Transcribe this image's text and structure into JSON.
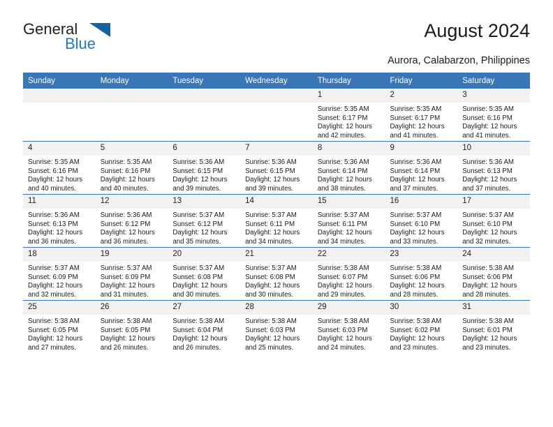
{
  "brand": {
    "line1": "General",
    "line2": "Blue",
    "triangle_icon": "blue-triangle-logo-mark",
    "color_dark": "#231f20",
    "color_blue": "#1f7ac4"
  },
  "header": {
    "title": "August 2024",
    "subtitle": "Aurora, Calabarzon, Philippines"
  },
  "theme": {
    "header_bg": "#3876b8",
    "header_text": "#ffffff",
    "daynum_bg": "#f1f1f1",
    "cell_bg": "#ffffff",
    "divider": "#3876b8"
  },
  "calendar": {
    "weekday_headers": [
      "Sunday",
      "Monday",
      "Tuesday",
      "Wednesday",
      "Thursday",
      "Friday",
      "Saturday"
    ],
    "labels": {
      "sunrise": "Sunrise:",
      "sunset": "Sunset:",
      "daylight": "Daylight:"
    },
    "weeks": [
      [
        {
          "day": "",
          "empty": true
        },
        {
          "day": "",
          "empty": true
        },
        {
          "day": "",
          "empty": true
        },
        {
          "day": "",
          "empty": true
        },
        {
          "day": "1",
          "sunrise": "Sunrise: 5:35 AM",
          "sunset": "Sunset: 6:17 PM",
          "daylight": "Daylight: 12 hours and 42 minutes."
        },
        {
          "day": "2",
          "sunrise": "Sunrise: 5:35 AM",
          "sunset": "Sunset: 6:17 PM",
          "daylight": "Daylight: 12 hours and 41 minutes."
        },
        {
          "day": "3",
          "sunrise": "Sunrise: 5:35 AM",
          "sunset": "Sunset: 6:16 PM",
          "daylight": "Daylight: 12 hours and 41 minutes."
        }
      ],
      [
        {
          "day": "4",
          "sunrise": "Sunrise: 5:35 AM",
          "sunset": "Sunset: 6:16 PM",
          "daylight": "Daylight: 12 hours and 40 minutes."
        },
        {
          "day": "5",
          "sunrise": "Sunrise: 5:35 AM",
          "sunset": "Sunset: 6:16 PM",
          "daylight": "Daylight: 12 hours and 40 minutes."
        },
        {
          "day": "6",
          "sunrise": "Sunrise: 5:36 AM",
          "sunset": "Sunset: 6:15 PM",
          "daylight": "Daylight: 12 hours and 39 minutes."
        },
        {
          "day": "7",
          "sunrise": "Sunrise: 5:36 AM",
          "sunset": "Sunset: 6:15 PM",
          "daylight": "Daylight: 12 hours and 39 minutes."
        },
        {
          "day": "8",
          "sunrise": "Sunrise: 5:36 AM",
          "sunset": "Sunset: 6:14 PM",
          "daylight": "Daylight: 12 hours and 38 minutes."
        },
        {
          "day": "9",
          "sunrise": "Sunrise: 5:36 AM",
          "sunset": "Sunset: 6:14 PM",
          "daylight": "Daylight: 12 hours and 37 minutes."
        },
        {
          "day": "10",
          "sunrise": "Sunrise: 5:36 AM",
          "sunset": "Sunset: 6:13 PM",
          "daylight": "Daylight: 12 hours and 37 minutes."
        }
      ],
      [
        {
          "day": "11",
          "sunrise": "Sunrise: 5:36 AM",
          "sunset": "Sunset: 6:13 PM",
          "daylight": "Daylight: 12 hours and 36 minutes."
        },
        {
          "day": "12",
          "sunrise": "Sunrise: 5:36 AM",
          "sunset": "Sunset: 6:12 PM",
          "daylight": "Daylight: 12 hours and 36 minutes."
        },
        {
          "day": "13",
          "sunrise": "Sunrise: 5:37 AM",
          "sunset": "Sunset: 6:12 PM",
          "daylight": "Daylight: 12 hours and 35 minutes."
        },
        {
          "day": "14",
          "sunrise": "Sunrise: 5:37 AM",
          "sunset": "Sunset: 6:11 PM",
          "daylight": "Daylight: 12 hours and 34 minutes."
        },
        {
          "day": "15",
          "sunrise": "Sunrise: 5:37 AM",
          "sunset": "Sunset: 6:11 PM",
          "daylight": "Daylight: 12 hours and 34 minutes."
        },
        {
          "day": "16",
          "sunrise": "Sunrise: 5:37 AM",
          "sunset": "Sunset: 6:10 PM",
          "daylight": "Daylight: 12 hours and 33 minutes."
        },
        {
          "day": "17",
          "sunrise": "Sunrise: 5:37 AM",
          "sunset": "Sunset: 6:10 PM",
          "daylight": "Daylight: 12 hours and 32 minutes."
        }
      ],
      [
        {
          "day": "18",
          "sunrise": "Sunrise: 5:37 AM",
          "sunset": "Sunset: 6:09 PM",
          "daylight": "Daylight: 12 hours and 32 minutes."
        },
        {
          "day": "19",
          "sunrise": "Sunrise: 5:37 AM",
          "sunset": "Sunset: 6:09 PM",
          "daylight": "Daylight: 12 hours and 31 minutes."
        },
        {
          "day": "20",
          "sunrise": "Sunrise: 5:37 AM",
          "sunset": "Sunset: 6:08 PM",
          "daylight": "Daylight: 12 hours and 30 minutes."
        },
        {
          "day": "21",
          "sunrise": "Sunrise: 5:37 AM",
          "sunset": "Sunset: 6:08 PM",
          "daylight": "Daylight: 12 hours and 30 minutes."
        },
        {
          "day": "22",
          "sunrise": "Sunrise: 5:38 AM",
          "sunset": "Sunset: 6:07 PM",
          "daylight": "Daylight: 12 hours and 29 minutes."
        },
        {
          "day": "23",
          "sunrise": "Sunrise: 5:38 AM",
          "sunset": "Sunset: 6:06 PM",
          "daylight": "Daylight: 12 hours and 28 minutes."
        },
        {
          "day": "24",
          "sunrise": "Sunrise: 5:38 AM",
          "sunset": "Sunset: 6:06 PM",
          "daylight": "Daylight: 12 hours and 28 minutes."
        }
      ],
      [
        {
          "day": "25",
          "sunrise": "Sunrise: 5:38 AM",
          "sunset": "Sunset: 6:05 PM",
          "daylight": "Daylight: 12 hours and 27 minutes."
        },
        {
          "day": "26",
          "sunrise": "Sunrise: 5:38 AM",
          "sunset": "Sunset: 6:05 PM",
          "daylight": "Daylight: 12 hours and 26 minutes."
        },
        {
          "day": "27",
          "sunrise": "Sunrise: 5:38 AM",
          "sunset": "Sunset: 6:04 PM",
          "daylight": "Daylight: 12 hours and 26 minutes."
        },
        {
          "day": "28",
          "sunrise": "Sunrise: 5:38 AM",
          "sunset": "Sunset: 6:03 PM",
          "daylight": "Daylight: 12 hours and 25 minutes."
        },
        {
          "day": "29",
          "sunrise": "Sunrise: 5:38 AM",
          "sunset": "Sunset: 6:03 PM",
          "daylight": "Daylight: 12 hours and 24 minutes."
        },
        {
          "day": "30",
          "sunrise": "Sunrise: 5:38 AM",
          "sunset": "Sunset: 6:02 PM",
          "daylight": "Daylight: 12 hours and 23 minutes."
        },
        {
          "day": "31",
          "sunrise": "Sunrise: 5:38 AM",
          "sunset": "Sunset: 6:01 PM",
          "daylight": "Daylight: 12 hours and 23 minutes."
        }
      ]
    ]
  }
}
